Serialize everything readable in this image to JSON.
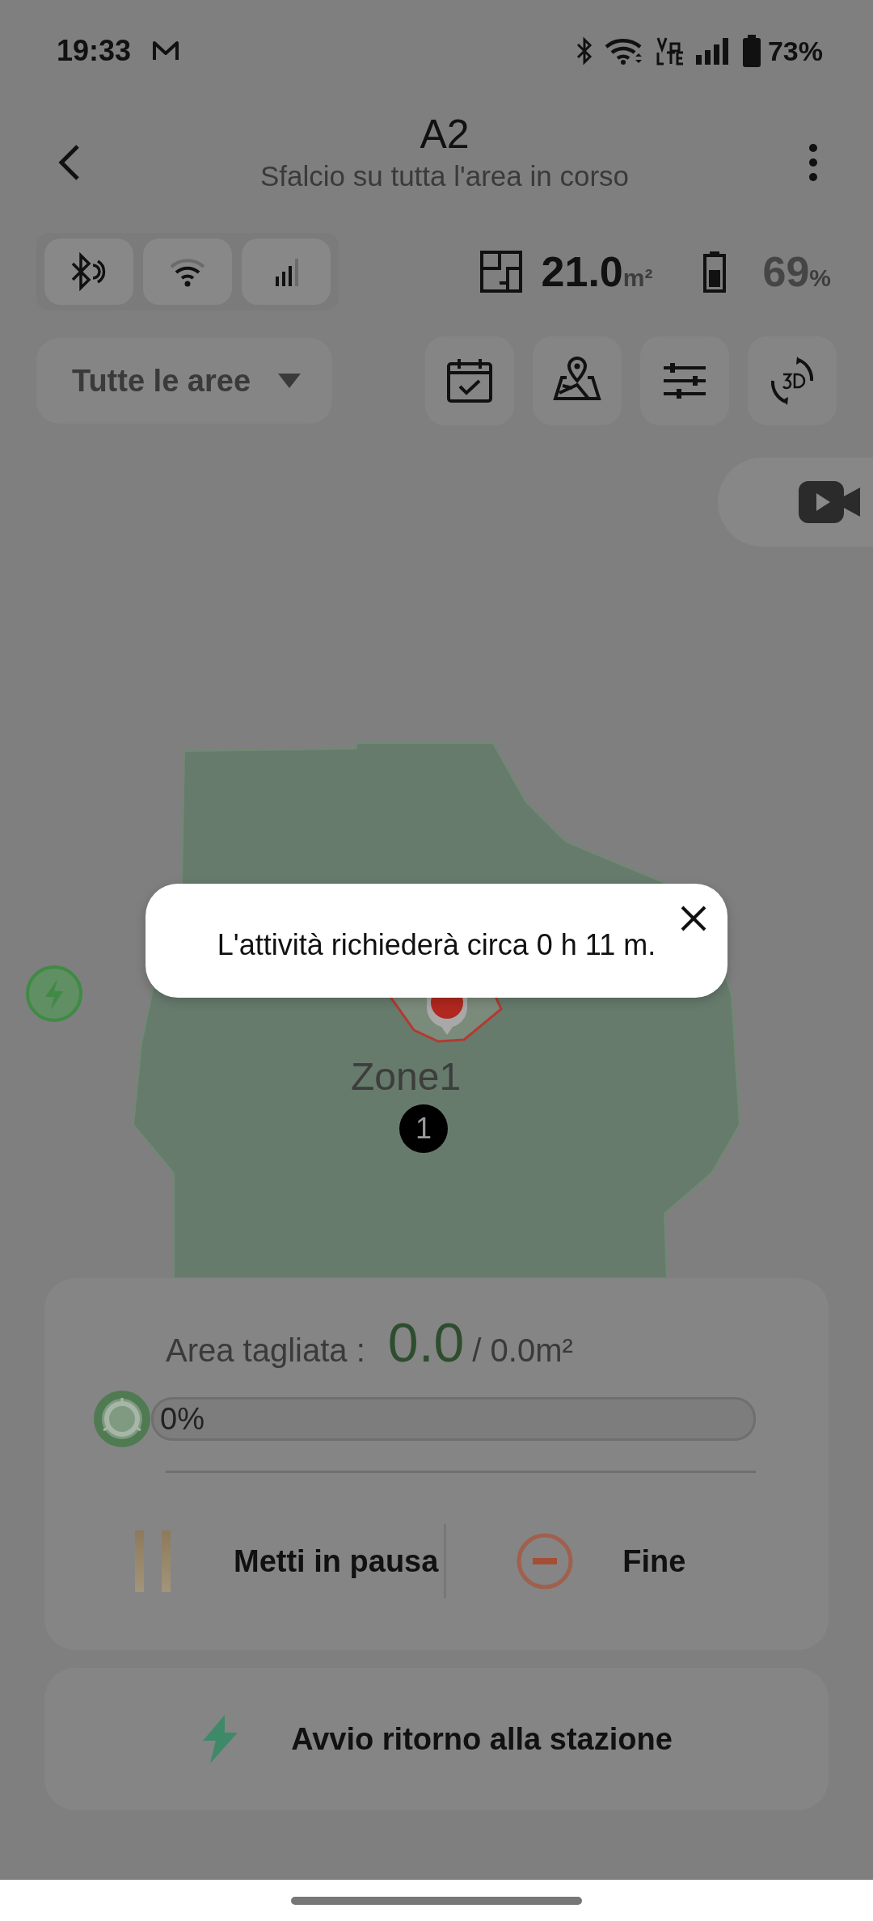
{
  "status_bar": {
    "time": "19:33",
    "battery": "73%"
  },
  "header": {
    "title": "A2",
    "subtitle": "Sfalcio su tutta l'area in corso"
  },
  "stats": {
    "area_value": "21.0",
    "area_unit": "m²",
    "battery_value": "69",
    "battery_unit": "%"
  },
  "area_selector": {
    "label": "Tutte le aree"
  },
  "map": {
    "zones": [
      {
        "label": "Zone1",
        "badge": "1"
      }
    ]
  },
  "popup": {
    "message": "L'attività richiederà circa 0 h 11 m."
  },
  "progress": {
    "label": "Area tagliata :",
    "cut": "0.0",
    "total": "/ 0.0m²",
    "level": 0,
    "percent": "0%"
  },
  "actions": [
    {
      "kind": "pause",
      "label": "Metti in pausa"
    },
    {
      "kind": "stop",
      "label": "Fine"
    }
  ],
  "return_button": {
    "label": "Avvio ritorno alla stazione"
  }
}
